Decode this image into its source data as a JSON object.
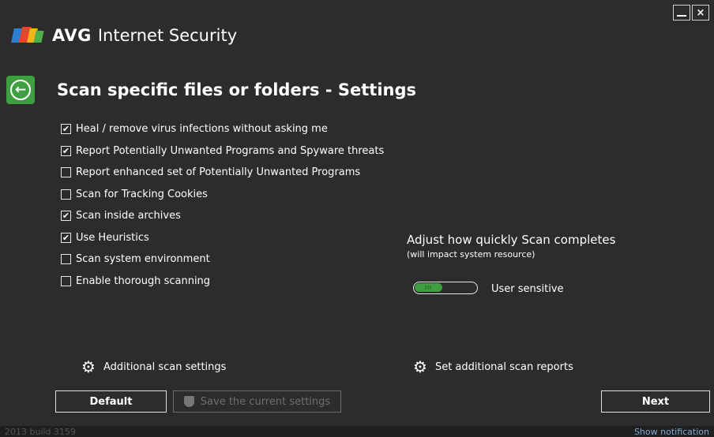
{
  "app": {
    "brand": "AVG",
    "product": "Internet Security"
  },
  "window_controls": {
    "minimize_icon": "minimize-icon",
    "close_glyph": "×"
  },
  "page": {
    "title": "Scan specific files or folders - Settings",
    "back_icon": "arrow-left-icon"
  },
  "options": [
    {
      "label": "Heal / remove virus infections without asking me",
      "checked": true
    },
    {
      "label": "Report Potentially Unwanted Programs and Spyware threats",
      "checked": true
    },
    {
      "label": "Report enhanced set of Potentially Unwanted Programs",
      "checked": false
    },
    {
      "label": "Scan for Tracking Cookies",
      "checked": false
    },
    {
      "label": "Scan inside archives",
      "checked": true
    },
    {
      "label": "Use Heuristics",
      "checked": true
    },
    {
      "label": "Scan system environment",
      "checked": false
    },
    {
      "label": "Enable thorough scanning",
      "checked": false
    }
  ],
  "speed": {
    "title": "Adjust how quickly Scan completes",
    "subtitle": "(will impact system resource)",
    "value": "User sensitive",
    "slider_level": 0.45,
    "slider_grip": "III"
  },
  "links": {
    "additional_settings": "Additional scan settings",
    "additional_reports": "Set additional scan reports"
  },
  "buttons": {
    "default": "Default",
    "save": "Save the current settings",
    "next": "Next"
  },
  "footer": {
    "build": "2013  build 3159",
    "show_notification": "Show notification"
  },
  "colors": {
    "accent_green": "#3f9e3f",
    "background": "#2c2c2c"
  }
}
